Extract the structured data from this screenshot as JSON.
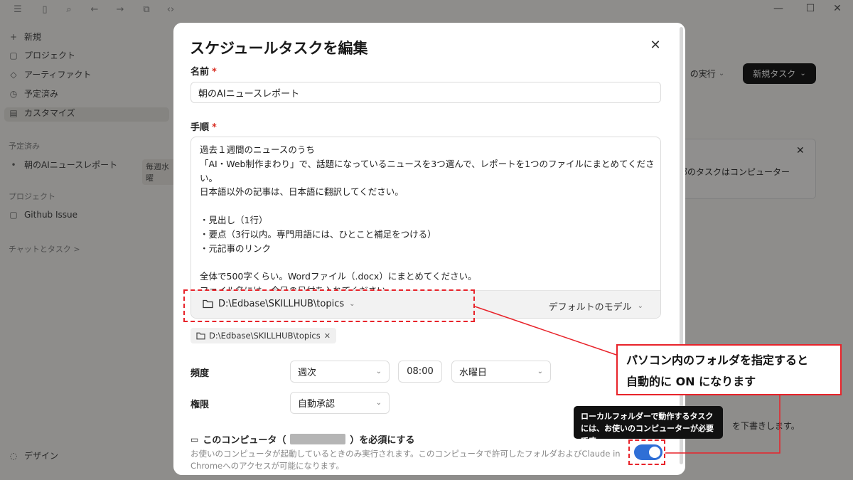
{
  "background": {
    "sidebar": {
      "items": [
        {
          "icon": "plus-icon",
          "label": "新規"
        },
        {
          "icon": "folder-icon",
          "label": "プロジェクト"
        },
        {
          "icon": "artifact-icon",
          "label": "アーティファクト"
        },
        {
          "icon": "clock-icon",
          "label": "予定済み"
        },
        {
          "icon": "customize-icon",
          "label": "カスタマイズ"
        }
      ],
      "scheduled_section": "予定済み",
      "scheduled_item": "朝のAIニュースレポート",
      "scheduled_badge": "毎週水曜",
      "projects_section": "プロジェクト",
      "project_item": "Github Issue",
      "chats_section": "チャットとタスク >",
      "design_item": "デザイン"
    },
    "header_button_light": "の実行",
    "header_button_dark": "新規タスク",
    "card_text": "部のタスクはコンピューター",
    "lower_text": "を下書きします。"
  },
  "modal": {
    "title": "スケジュールタスクを編集",
    "name_label": "名前",
    "name_value": "朝のAIニュースレポート",
    "steps_label": "手順",
    "steps_text": "過去１週間のニュースのうち\n「AI・Web制作まわり」で、話題になっているニュースを3つ選んで、レポートを1つのファイルにまとめてください。\n日本語以外の記事は、日本語に翻訳してください。\n\n・見出し（1行）\n・要点（3行以内。専門用語には、ひとこと補足をつける）\n・元記事のリンク\n\n全体で500字くらい。Wordファイル（.docx）にまとめてください。\nファイル名には、今日の日付を入れてください。",
    "folder_path": "D:\\Edbase\\SKILLHUB\\topics",
    "model_label": "デフォルトのモデル",
    "chip_path": "D:\\Edbase\\SKILLHUB\\topics",
    "frequency_label": "頻度",
    "frequency_value": "週次",
    "time_value": "08:00",
    "weekday_value": "水曜日",
    "permission_label": "権限",
    "permission_value": "自動承認",
    "computer_prefix": "このコンピュータ（",
    "computer_suffix": "）を必須にする",
    "description": "お使いのコンピュータが起動しているときのみ実行されます。このコンピュータで許可したフォルダおよびClaude in Chromeへのアクセスが可能になります。",
    "toggle_on": true,
    "tooltip": "ローカルフォルダーで動作するタスクには、お使いのコンピューターが必要です。"
  },
  "annotation": {
    "callout_line1": "パソコン内のフォルダを指定すると",
    "callout_line2": "自動的に ON になります",
    "color": "#e8232a"
  }
}
